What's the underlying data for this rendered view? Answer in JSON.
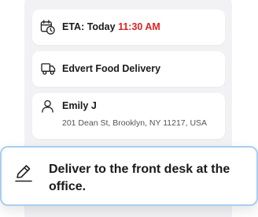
{
  "eta": {
    "label": "ETA: Today",
    "time": "11:30 AM",
    "icon": "calendar-clock-icon",
    "time_color": "#e02424"
  },
  "company": {
    "name": "Edvert Food Delivery",
    "icon": "truck-icon"
  },
  "customer": {
    "name": "Emily J",
    "address": "201 Dean St, Brooklyn, NY 11217, USA",
    "icon": "person-icon"
  },
  "note": {
    "text": "Deliver to the front desk at the office.",
    "icon": "edit-pencil-icon",
    "border_color": "#a9cdf3"
  }
}
